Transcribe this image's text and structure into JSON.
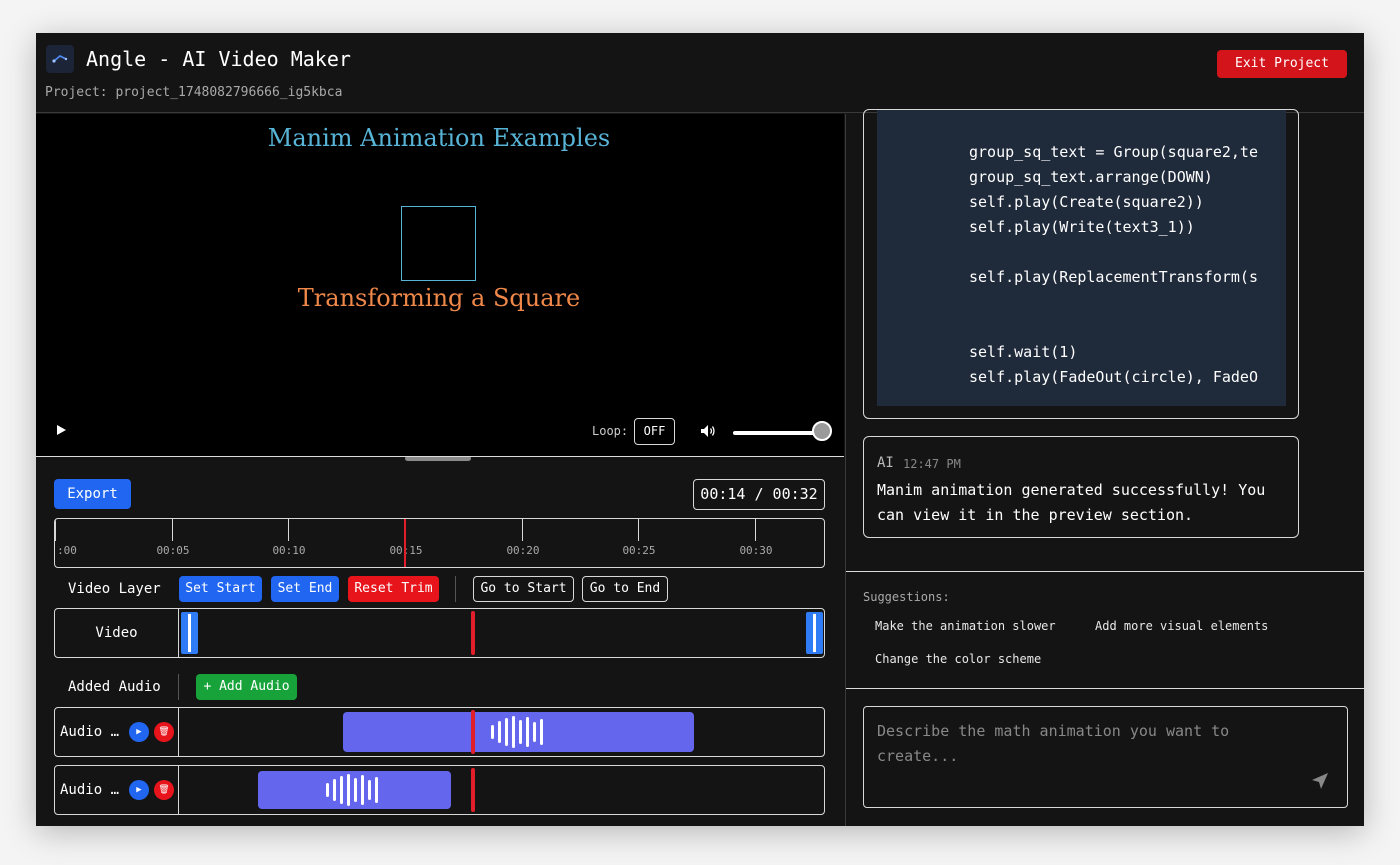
{
  "header": {
    "app_title": "Angle - AI Video Maker",
    "project": "Project: project_1748082796666_ig5kbca",
    "exit_label": "Exit Project"
  },
  "preview": {
    "scene_title": "Manim Animation Examples",
    "scene_caption": "Transforming a Square",
    "loop_label": "Loop:",
    "loop_value": "OFF",
    "volume": 1.0
  },
  "timeline": {
    "export_label": "Export",
    "time_display": "00:14 / 00:32",
    "ruler_ticks": [
      ":00",
      "00:05",
      "00:10",
      "00:15",
      "00:20",
      "00:25",
      "00:30"
    ],
    "video_layer_label": "Video Layer",
    "set_start_label": "Set Start",
    "set_end_label": "Set End",
    "reset_trim_label": "Reset Trim",
    "go_start_label": "Go to Start",
    "go_end_label": "Go to End",
    "video_track_name": "Video",
    "added_audio_label": "Added Audio",
    "add_audio_label": "+ Add Audio",
    "audio_tracks": [
      {
        "name": "Audio …"
      },
      {
        "name": "Audio …"
      }
    ]
  },
  "chat": {
    "code_lines": [
      "group_sq_text = Group(square2,te",
      "group_sq_text.arrange(DOWN)",
      "self.play(Create(square2))",
      "self.play(Write(text3_1))",
      "",
      "self.play(ReplacementTransform(s",
      "",
      "",
      "self.wait(1)",
      "self.play(FadeOut(circle), FadeO"
    ],
    "message": {
      "author": "AI",
      "time": "12:47 PM",
      "text": "Manim animation generated successfully! You can view it in the preview section."
    },
    "suggestions_label": "Suggestions:",
    "suggestions": [
      "Make the animation slower",
      "Add more visual elements",
      "Change the color scheme"
    ],
    "input_placeholder": "Describe the math animation you want to create..."
  },
  "colors": {
    "accent_blue": "#2166f0",
    "danger_red": "#e8141b",
    "success_green": "#18a33a",
    "audio_clip": "#6466ee",
    "playhead": "#e31e2b"
  },
  "icons": [
    "logo-icon",
    "play-icon",
    "volume-icon",
    "play-audio-icon",
    "trash-icon",
    "send-icon"
  ]
}
